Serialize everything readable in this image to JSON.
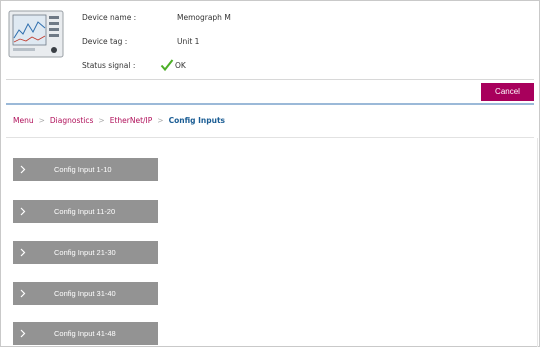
{
  "device": {
    "name_label": "Device name :",
    "name_value": "Memograph M",
    "tag_label": "Device tag :",
    "tag_value": "Unit 1",
    "status_label": "Status signal :",
    "status_value": "OK"
  },
  "actions": {
    "cancel_label": "Cancel"
  },
  "breadcrumb": {
    "items": [
      "Menu",
      "Diagnostics",
      "EtherNet/IP"
    ],
    "current": "Config Inputs",
    "separator": ">"
  },
  "config_inputs": [
    {
      "label": "Config Input 1-10"
    },
    {
      "label": "Config Input 11-20"
    },
    {
      "label": "Config Input 21-30"
    },
    {
      "label": "Config Input 31-40"
    },
    {
      "label": "Config Input 41-48"
    }
  ],
  "icons": {
    "device": "device-thumbnail-icon",
    "status": "checkmark-icon",
    "expand": "chevron-right-icon"
  },
  "colors": {
    "cancel_bg": "#a8005c",
    "breadcrumb_link": "#b0105a",
    "breadcrumb_current": "#1b5d94",
    "status_ok": "#4caf27",
    "config_button_bg": "#939393",
    "divider_accent": "#9bb9d8"
  }
}
